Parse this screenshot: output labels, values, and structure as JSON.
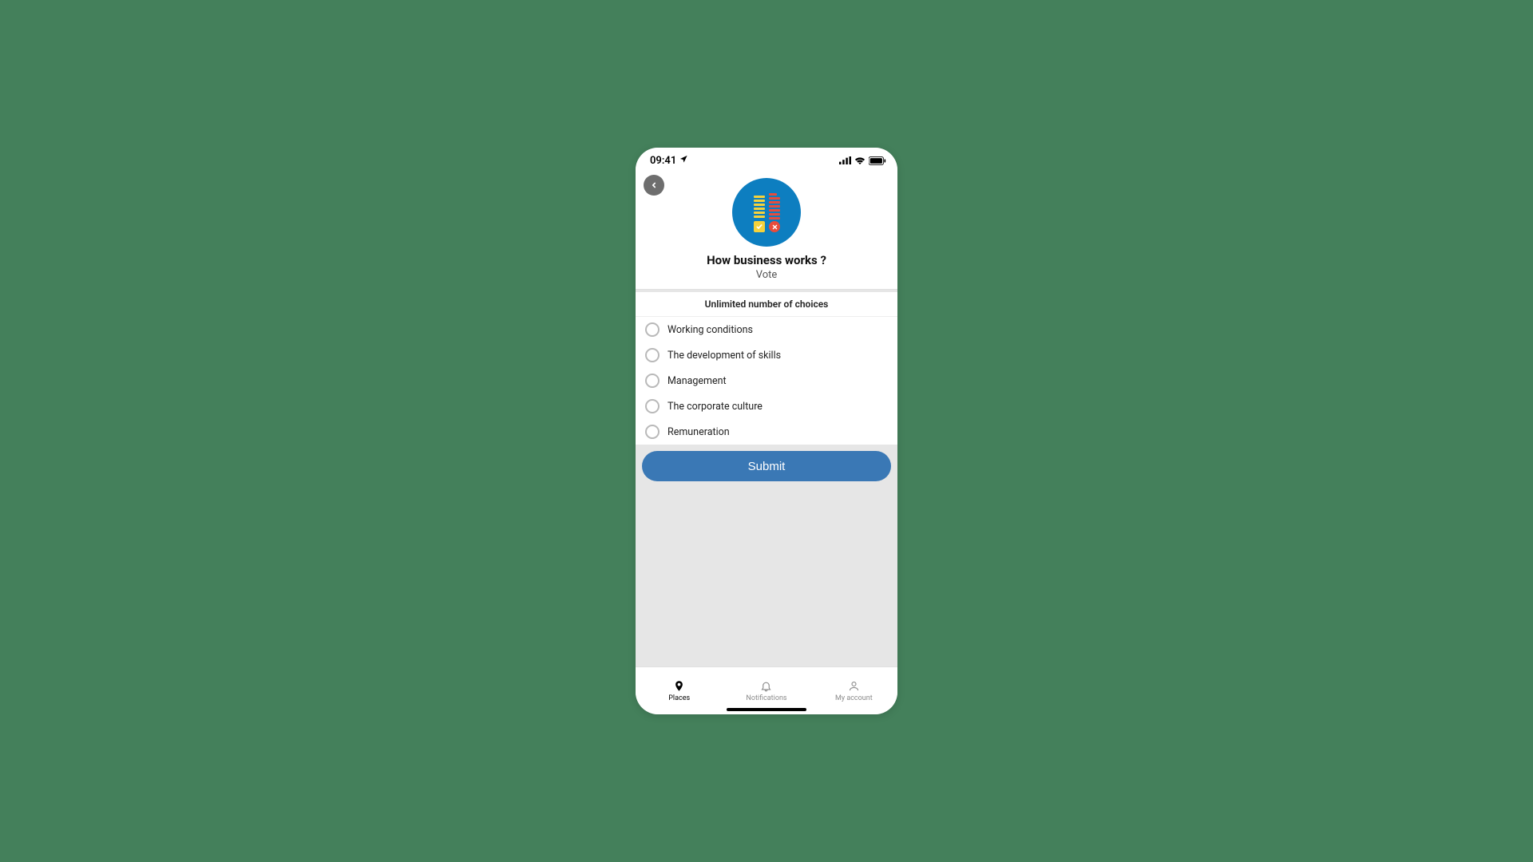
{
  "status": {
    "time": "09:41"
  },
  "header": {
    "title": "How business works ?",
    "subtitle": "Vote"
  },
  "instruction": "Unlimited number of choices",
  "options": [
    {
      "label": "Working conditions"
    },
    {
      "label": "The development of skills"
    },
    {
      "label": "Management"
    },
    {
      "label": "The corporate culture"
    },
    {
      "label": "Remuneration"
    }
  ],
  "submit_label": "Submit",
  "tabs": {
    "places": "Places",
    "notifications": "Notifications",
    "account": "My account"
  }
}
